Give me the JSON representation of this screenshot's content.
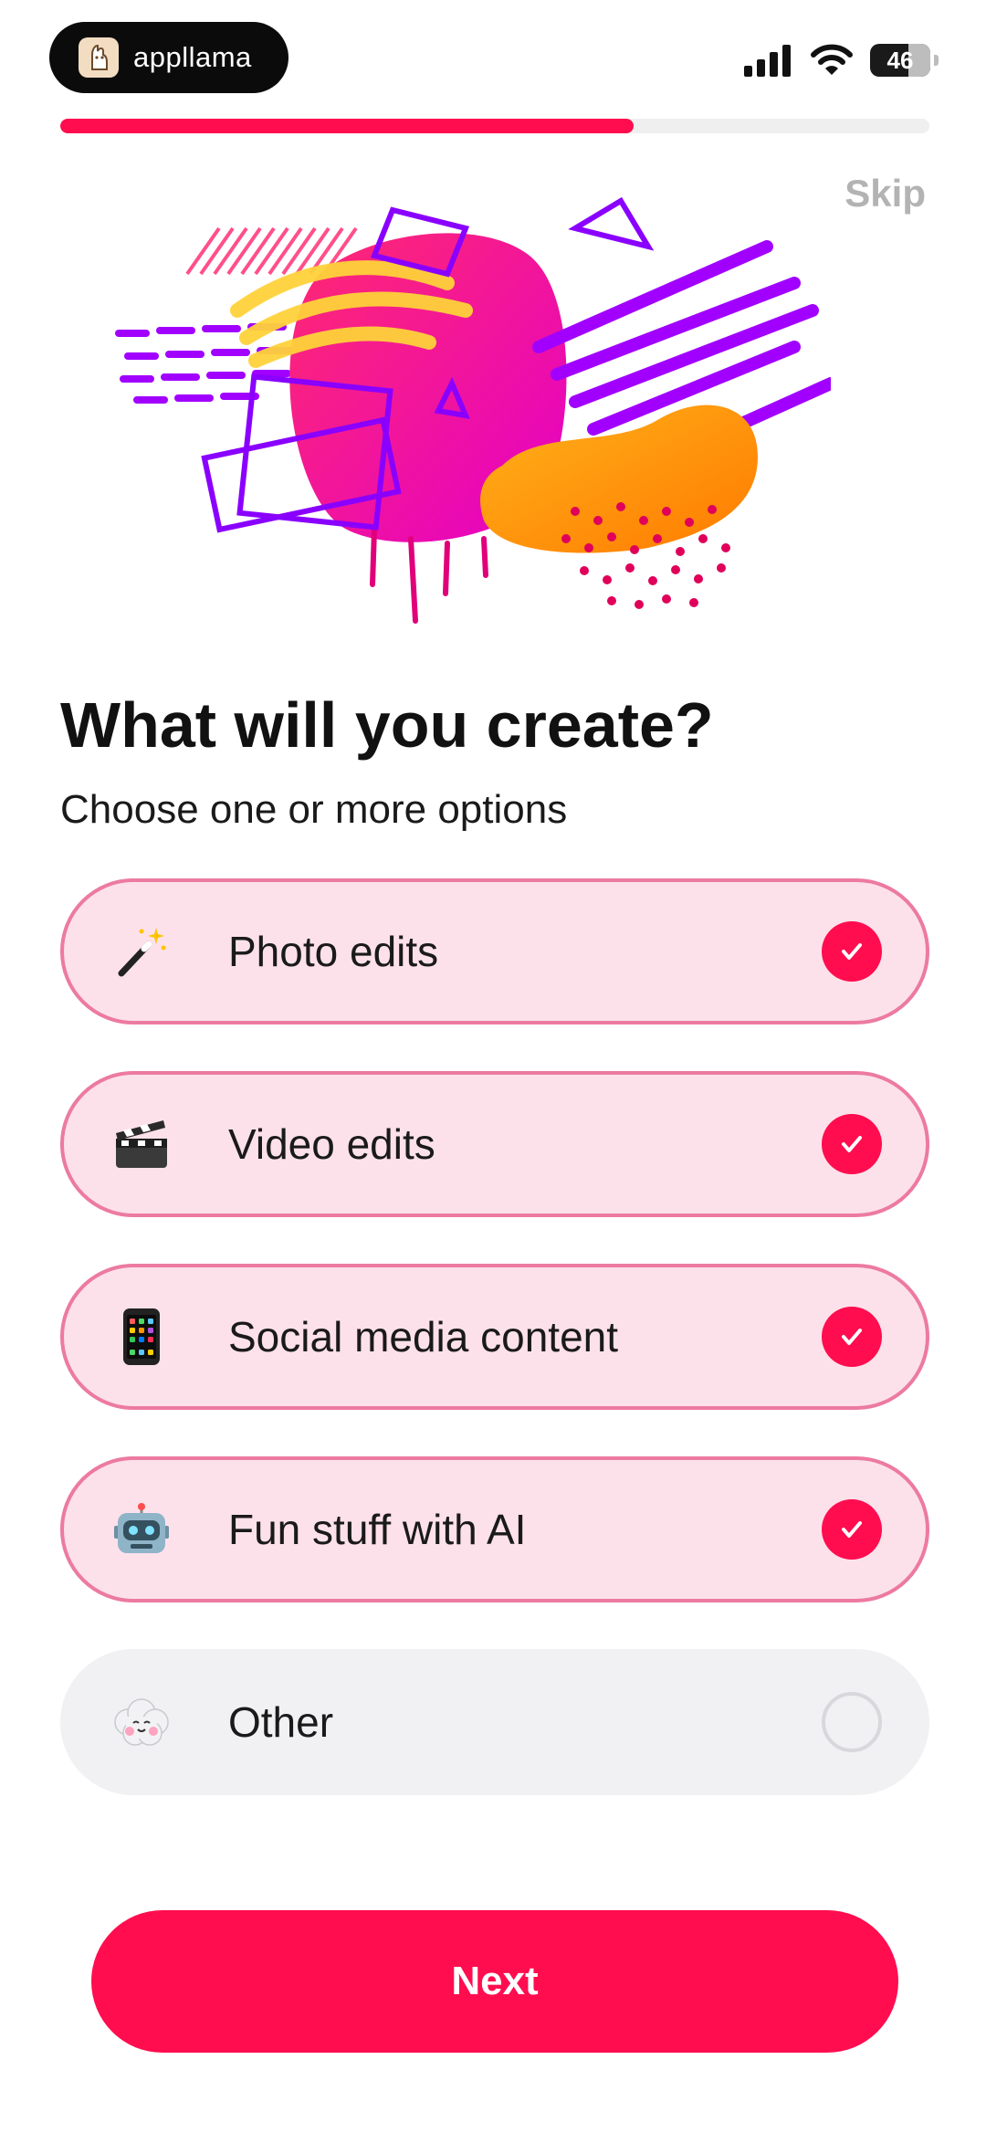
{
  "status_bar": {
    "app_name": "appllama",
    "battery": "46"
  },
  "progress": {
    "value": 0.66
  },
  "header": {
    "skip_label": "Skip"
  },
  "title": "What will you create?",
  "subtitle": "Choose one or more options",
  "options": [
    {
      "label": "Photo edits",
      "icon": "magic-wand-icon",
      "selected": true
    },
    {
      "label": "Video edits",
      "icon": "clapper-board-icon",
      "selected": true
    },
    {
      "label": "Social media content",
      "icon": "mobile-phone-icon",
      "selected": true
    },
    {
      "label": "Fun stuff with AI",
      "icon": "robot-icon",
      "selected": true
    },
    {
      "label": "Other",
      "icon": "cloud-face-icon",
      "selected": false
    }
  ],
  "next_label": "Next",
  "colors": {
    "accent": "#ff0d4f",
    "selected_bg": "#fde1ea",
    "selected_border": "#ec7aa1",
    "unselected_bg": "#f1f1f3"
  }
}
